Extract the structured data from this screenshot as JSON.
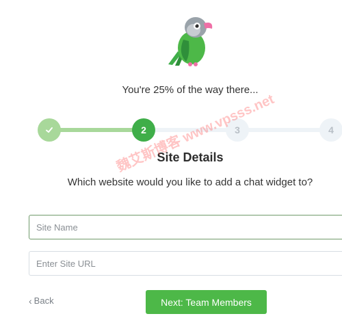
{
  "progress": {
    "text": "You're 25% of the way there...",
    "percent": 25
  },
  "stepper": {
    "steps": [
      {
        "label": "",
        "state": "completed",
        "icon": "check-icon"
      },
      {
        "label": "2",
        "state": "active"
      },
      {
        "label": "3",
        "state": "upcoming"
      },
      {
        "label": "4",
        "state": "upcoming"
      }
    ]
  },
  "section": {
    "title": "Site Details",
    "subtitle": "Which website would you like to add a chat widget to?"
  },
  "form": {
    "site_name_placeholder": "Site Name",
    "site_url_placeholder": "Enter Site URL"
  },
  "footer": {
    "back_label": "Back",
    "next_label": "Next: Team Members"
  },
  "watermark": {
    "text": "魏艾斯博客 www.vpsss.net"
  },
  "colors": {
    "primary_green": "#4db848",
    "completed_green": "#a8d89a",
    "inactive_gray": "#eef3f7"
  }
}
